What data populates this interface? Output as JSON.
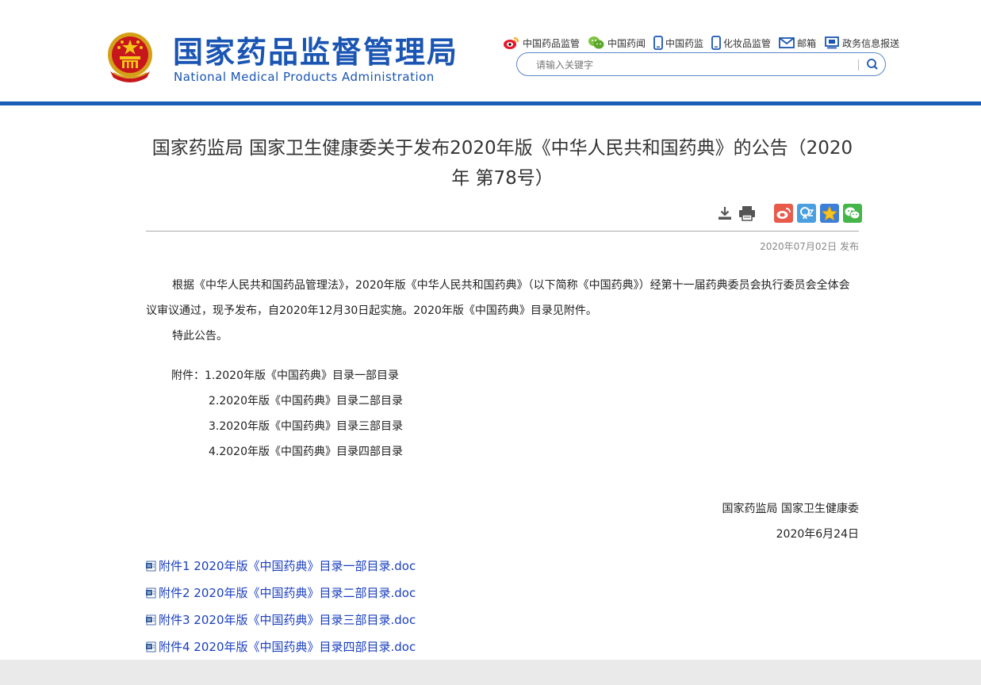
{
  "header": {
    "title_cn": "国家药品监督管理局",
    "title_en": "National Medical Products Administration",
    "links": [
      {
        "label": "中国药品监管",
        "icon": "weibo-icon"
      },
      {
        "label": "中国药闻",
        "icon": "wechat-icon"
      },
      {
        "label": "中国药监",
        "icon": "mobile-icon"
      },
      {
        "label": "化妆品监管",
        "icon": "mobile-icon"
      },
      {
        "label": "邮箱",
        "icon": "mail-icon"
      },
      {
        "label": "政务信息报送",
        "icon": "monitor-icon"
      }
    ],
    "search": {
      "placeholder": "请输入关键字"
    }
  },
  "article": {
    "title": "国家药监局 国家卫生健康委关于发布2020年版《中华人民共和国药典》的公告（2020年 第78号）",
    "publish_date": "2020年07月02日 发布",
    "paragraphs": [
      "根据《中华人民共和国药品管理法》，2020年版《中华人民共和国药典》（以下简称《中国药典》）经第十一届药典委员会执行委员会全体会议审议通过，现予发布，自2020年12月30日起实施。2020年版《中国药典》目录见附件。",
      "特此公告。"
    ],
    "annex_label": "附件：",
    "annex_items": [
      "1.2020年版《中国药典》目录一部目录",
      "2.2020年版《中国药典》目录二部目录",
      "3.2020年版《中国药典》目录三部目录",
      "4.2020年版《中国药典》目录四部目录"
    ],
    "signer": "国家药监局 国家卫生健康委",
    "sign_date": "2020年6月24日",
    "attachments": [
      "附件1 2020年版《中国药典》目录一部目录.doc",
      "附件2 2020年版《中国药典》目录二部目录.doc",
      "附件3 2020年版《中国药典》目录三部目录.doc",
      "附件4 2020年版《中国药典》目录四部目录.doc"
    ]
  },
  "colors": {
    "brand_blue": "#1a55b3",
    "link_blue": "#1a3fc0",
    "weibo_share": "#e85a4a",
    "qzone_share": "#4a9fe0",
    "star_share": "#3c7fd8",
    "wechat_share": "#44b549"
  }
}
